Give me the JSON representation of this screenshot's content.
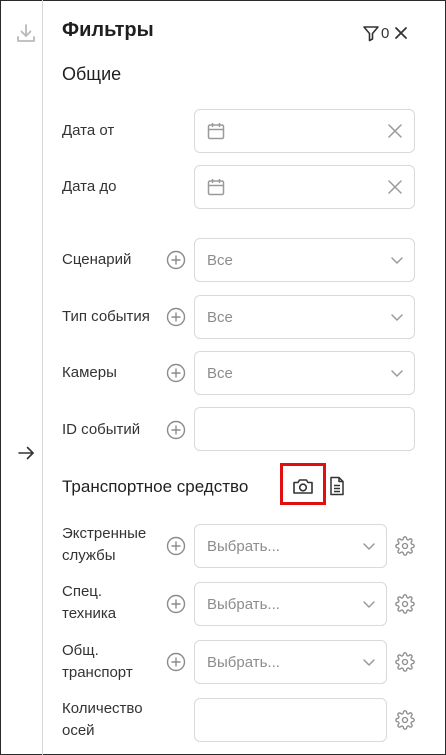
{
  "panel": {
    "title": "Фильтры",
    "filter_count": "0"
  },
  "general": {
    "heading": "Общие",
    "date_from_label": "Дата от",
    "date_to_label": "Дата до",
    "scenario_label": "Сценарий",
    "scenario_value": "Все",
    "event_type_label": "Тип события",
    "event_type_value": "Все",
    "cameras_label": "Камеры",
    "cameras_value": "Все",
    "event_ids_label": "ID событий"
  },
  "vehicle": {
    "heading": "Транспортное средство",
    "emergency_label_1": "Экстренные",
    "emergency_label_2": "службы",
    "emergency_placeholder": "Выбрать...",
    "special_label_1": "Спец.",
    "special_label_2": "техника",
    "special_placeholder": "Выбрать...",
    "public_label_1": "Общ.",
    "public_label_2": "транспорт",
    "public_placeholder": "Выбрать...",
    "axles_label_1": "Количество",
    "axles_label_2": "осей"
  },
  "icons": {
    "download": "download-icon",
    "arrow": "arrow-right-icon",
    "filter": "filter-icon",
    "close": "close-icon",
    "calendar": "calendar-icon",
    "plus": "plus-circle-icon",
    "chevron": "chevron-down-icon",
    "camera": "camera-icon",
    "document": "document-icon",
    "gear": "gear-icon"
  },
  "colors": {
    "highlight": "#e01010",
    "border": "#d9d9d9",
    "placeholder": "#8d8d8d"
  }
}
